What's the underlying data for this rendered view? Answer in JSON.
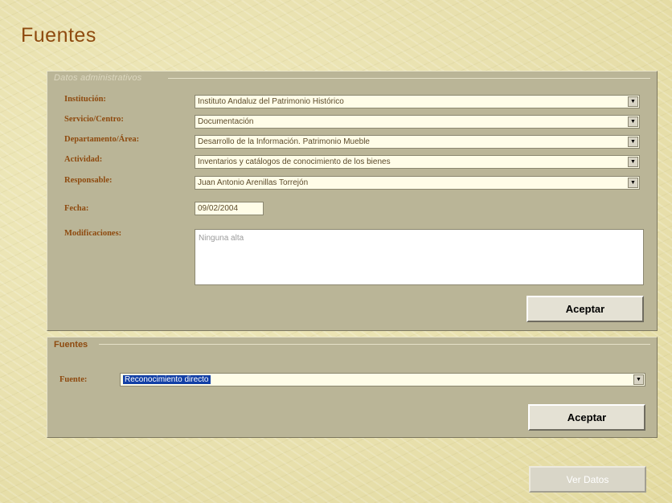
{
  "page": {
    "title": "Fuentes"
  },
  "datos_panel": {
    "legend": "Datos administrativos",
    "fields": [
      {
        "label": "Institución:",
        "value": "Instituto Andaluz del Patrimonio Histórico"
      },
      {
        "label": "Servicio/Centro:",
        "value": "Documentación"
      },
      {
        "label": "Departamento/Área:",
        "value": "Desarrollo de la Información. Patrimonio Mueble"
      },
      {
        "label": "Actividad:",
        "value": "Inventarios y catálogos de conocimiento de los bienes"
      },
      {
        "label": "Responsable:",
        "value": "Juan Antonio Arenillas Torrejón"
      }
    ],
    "fecha": {
      "label": "Fecha:",
      "value": "09/02/2004"
    },
    "modificaciones": {
      "label": "Modificaciones:",
      "value": "Ninguna alta"
    },
    "accept_label": "Aceptar"
  },
  "fuentes_panel": {
    "legend": "Fuentes",
    "fuente": {
      "label": "Fuente:",
      "value": "Reconocimiento directo"
    },
    "accept_label": "Aceptar"
  },
  "footer": {
    "ver_datos_label": "Ver Datos"
  },
  "icons": {
    "dropdown": "chevron-down-icon"
  },
  "colors": {
    "label": "#8e4a0f",
    "panel": "#bab597",
    "selection": "#123fa6",
    "background": "#ece5b4"
  }
}
